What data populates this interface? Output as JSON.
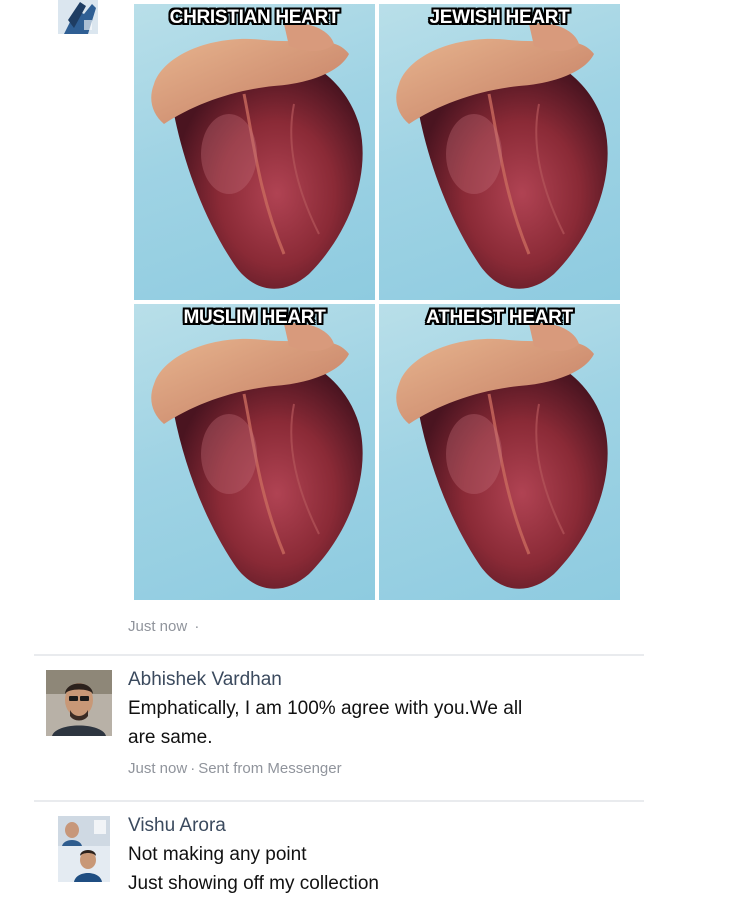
{
  "post": {
    "image_captions": [
      "CHRISTIAN HEART",
      "JEWISH HEART",
      "MUSLIM HEART",
      "ATHEIST HEART"
    ],
    "timestamp": "Just now"
  },
  "comments": [
    {
      "author": "Abhishek Vardhan",
      "lines": [
        "Emphatically, I am 100% agree with you.We all",
        "are same."
      ],
      "timestamp": "Just now",
      "source": "Sent from Messenger"
    },
    {
      "author": "Vishu Arora",
      "lines": [
        "Not making any point",
        "Just showing off my collection"
      ]
    }
  ],
  "colors": {
    "meta_gray": "#90949c",
    "divider": "#e9ebee",
    "panel_bg": "#9fd3e4",
    "heart_red": "#8e2b37"
  },
  "icons": {
    "separator": "·"
  }
}
